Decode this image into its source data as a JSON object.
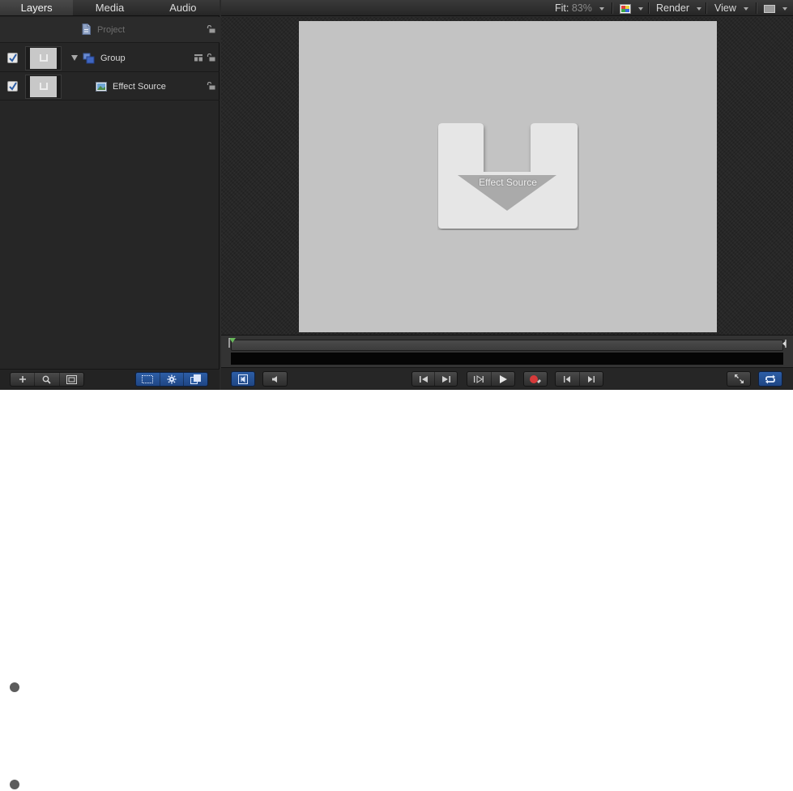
{
  "left_panel": {
    "tabs": [
      {
        "label": "Layers",
        "active": true
      },
      {
        "label": "Media",
        "active": false
      },
      {
        "label": "Audio",
        "active": false
      }
    ],
    "rows": {
      "project": {
        "label": "Project",
        "icon": "document-icon",
        "locked": false
      },
      "group": {
        "label": "Group",
        "icon": "group-icon",
        "enabled": true,
        "expanded": true
      },
      "effect_source": {
        "label": "Effect Source",
        "icon": "image-layer-icon",
        "enabled": true
      }
    }
  },
  "toolbar": {
    "fit_label": "Fit:",
    "fit_value": "83%",
    "render_label": "Render",
    "view_label": "View"
  },
  "canvas": {
    "placeholder_text": "Effect Source"
  },
  "colors": {
    "accent_blue": "#2d5ea6",
    "canvas_gray": "#c3c3c3",
    "record_red": "#d63a3a",
    "playhead_green": "#67b85a"
  }
}
